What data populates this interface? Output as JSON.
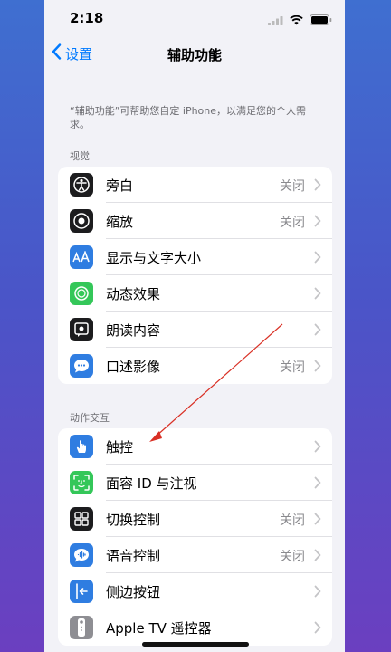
{
  "status_bar": {
    "time": "2:18"
  },
  "nav": {
    "back_label": "设置",
    "title": "辅助功能"
  },
  "description": "“辅助功能”可帮助您自定 iPhone，以满足您的个人需求。",
  "sections": [
    {
      "header": "视觉",
      "rows": [
        {
          "label": "旁白",
          "value": "关闭",
          "icon": "voiceover-icon",
          "color": "#1c1c1e"
        },
        {
          "label": "缩放",
          "value": "关闭",
          "icon": "zoom-icon",
          "color": "#1c1c1e"
        },
        {
          "label": "显示与文字大小",
          "value": "",
          "icon": "text-size-icon",
          "color": "#2f7de1"
        },
        {
          "label": "动态效果",
          "value": "",
          "icon": "motion-icon",
          "color": "#34c759"
        },
        {
          "label": "朗读内容",
          "value": "",
          "icon": "spoken-content-icon",
          "color": "#1c1c1e"
        },
        {
          "label": "口述影像",
          "value": "关闭",
          "icon": "audio-description-icon",
          "color": "#2f7de1"
        }
      ]
    },
    {
      "header": "动作交互",
      "rows": [
        {
          "label": "触控",
          "value": "",
          "icon": "touch-icon",
          "color": "#2f7de1"
        },
        {
          "label": "面容 ID 与注视",
          "value": "",
          "icon": "face-id-icon",
          "color": "#34c759"
        },
        {
          "label": "切换控制",
          "value": "关闭",
          "icon": "switch-control-icon",
          "color": "#1c1c1e"
        },
        {
          "label": "语音控制",
          "value": "关闭",
          "icon": "voice-control-icon",
          "color": "#2f7de1"
        },
        {
          "label": "侧边按钮",
          "value": "",
          "icon": "side-button-icon",
          "color": "#2f7de1"
        },
        {
          "label": "Apple TV 遥控器",
          "value": "",
          "icon": "apple-tv-remote-icon",
          "color": "#8e8e93"
        }
      ]
    }
  ],
  "annotation": {
    "color": "#d93025"
  }
}
